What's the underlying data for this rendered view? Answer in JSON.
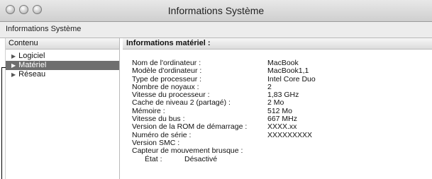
{
  "window": {
    "title": "Informations Système"
  },
  "toolbar": {
    "crumb": "Informations Système"
  },
  "sidebar": {
    "header": "Contenu",
    "items": [
      {
        "label": "Logiciel",
        "selected": false
      },
      {
        "label": "Matériel",
        "selected": true
      },
      {
        "label": "Réseau",
        "selected": false
      }
    ]
  },
  "content": {
    "header": "Informations matériel :",
    "rows": [
      {
        "key": "Nom de l'ordinateur :",
        "value": "MacBook"
      },
      {
        "key": "Modèle d'ordinateur :",
        "value": "MacBook1,1"
      },
      {
        "key": "Type de processeur :",
        "value": "Intel Core Duo"
      },
      {
        "key": "Nombre de noyaux :",
        "value": "2"
      },
      {
        "key": "Vitesse du processeur :",
        "value": "1,83 GHz"
      },
      {
        "key": "Cache de niveau 2 (partagé) :",
        "value": "2 Mo"
      },
      {
        "key": "Mémoire :",
        "value": "512 Mo"
      },
      {
        "key": "Vitesse du bus :",
        "value": "667 MHz"
      },
      {
        "key": "Version de la ROM de démarrage :",
        "value": "XXXX.xx"
      },
      {
        "key": "Numéro de série :",
        "value": "XXXXXXXXX"
      },
      {
        "key": "Version SMC :",
        "value": ""
      },
      {
        "key": "Capteur de mouvement brusque :",
        "value": ""
      }
    ],
    "sub_rows": [
      {
        "key": "État :",
        "value": "Désactivé"
      }
    ]
  },
  "icons": {
    "collapse_triangle": "triangle-right-icon"
  }
}
